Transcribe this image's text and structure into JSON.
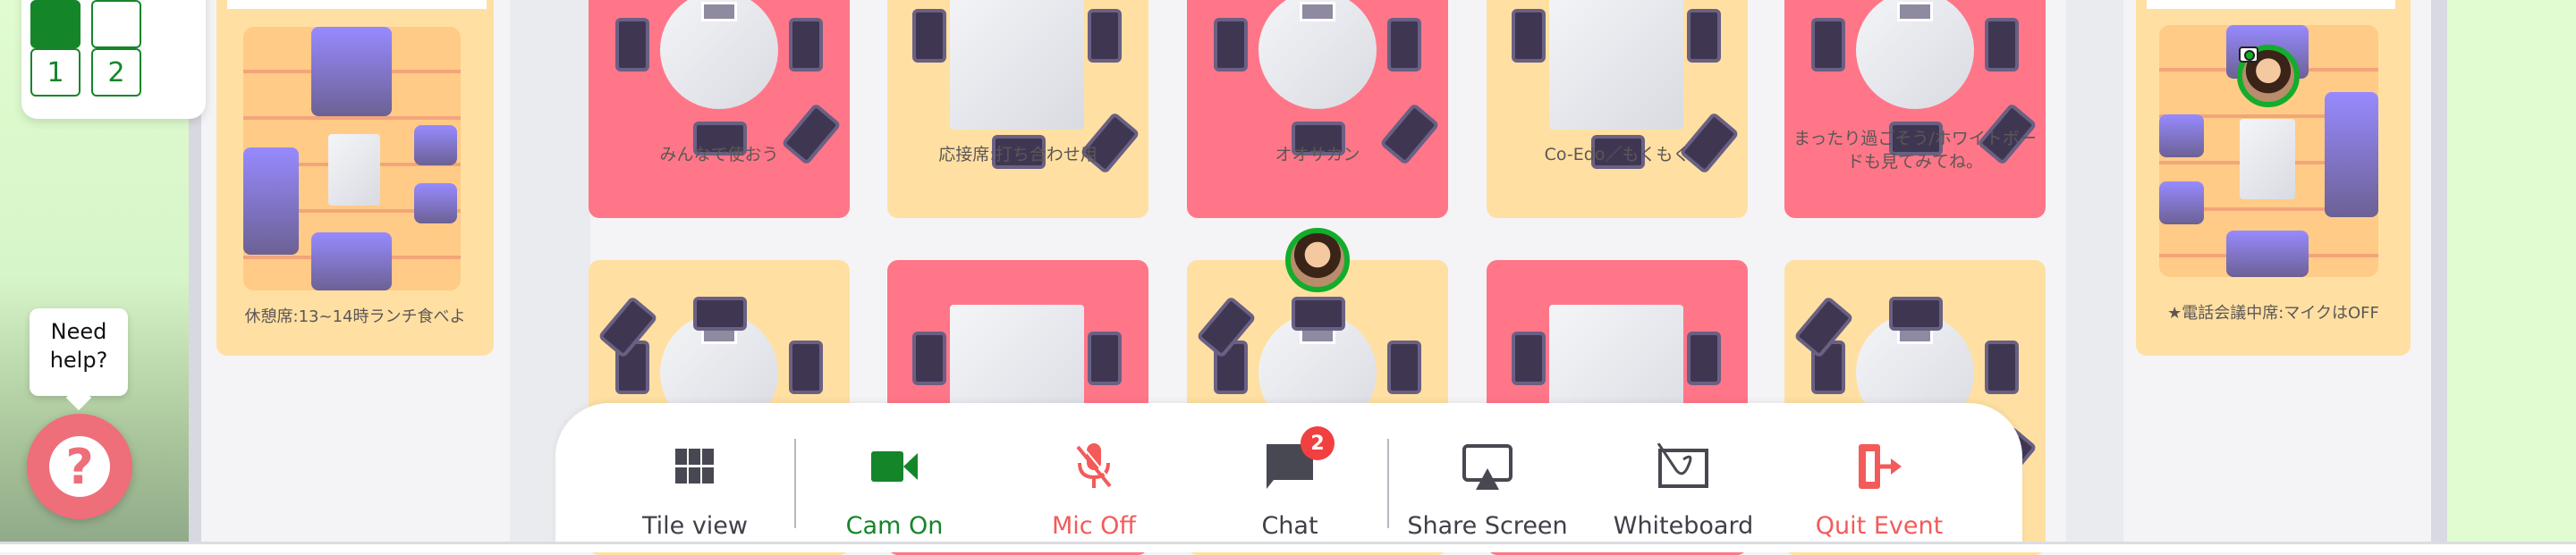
{
  "floor_selector": {
    "buttons": [
      {
        "label": "",
        "active": true
      },
      {
        "label": "",
        "active": false
      },
      {
        "label": "1",
        "active": false
      },
      {
        "label": "2",
        "active": false
      }
    ]
  },
  "help": {
    "bubble": "Need help?",
    "icon": "question-icon"
  },
  "side_rooms": [
    {
      "label": "休憩席:13~14時ランチ食べよ",
      "color": "#ffe0a2"
    },
    {
      "label": "★電話会議中席:マイクはOFF",
      "color": "#ffe0a2"
    }
  ],
  "rooms_row1": [
    {
      "label": "みんなで使おう",
      "color": "#ff7688"
    },
    {
      "label": "応接席:打ち合わせ用",
      "color": "#ffe0a2"
    },
    {
      "label": "オオサカン",
      "color": "#ff7688"
    },
    {
      "label": "Co-Edo／もくもく",
      "color": "#ffe0a2"
    },
    {
      "label": "まったり過ごそう/ホワイトボードも見てみてね。",
      "color": "#ff7688"
    }
  ],
  "rooms_row2": [
    {
      "color": "#ffe0a2"
    },
    {
      "color": "#ff7688"
    },
    {
      "color": "#ffe0a2"
    },
    {
      "color": "#ff7688"
    },
    {
      "color": "#ffe0a2"
    }
  ],
  "toolbar": {
    "tile_view": {
      "label": "Tile view",
      "icon": "grid-icon"
    },
    "cam": {
      "label": "Cam On",
      "icon": "video-camera-icon",
      "color": "#15852a"
    },
    "mic": {
      "label": "Mic Off",
      "icon": "microphone-off-icon",
      "color": "#f35a5a"
    },
    "chat": {
      "label": "Chat",
      "icon": "chat-bubble-icon",
      "badge": "2"
    },
    "share": {
      "label": "Share Screen",
      "icon": "screen-share-icon"
    },
    "whiteboard": {
      "label": "Whiteboard",
      "icon": "whiteboard-icon"
    },
    "quit": {
      "label": "Quit Event",
      "icon": "exit-door-icon",
      "color": "#f35a5a"
    }
  }
}
